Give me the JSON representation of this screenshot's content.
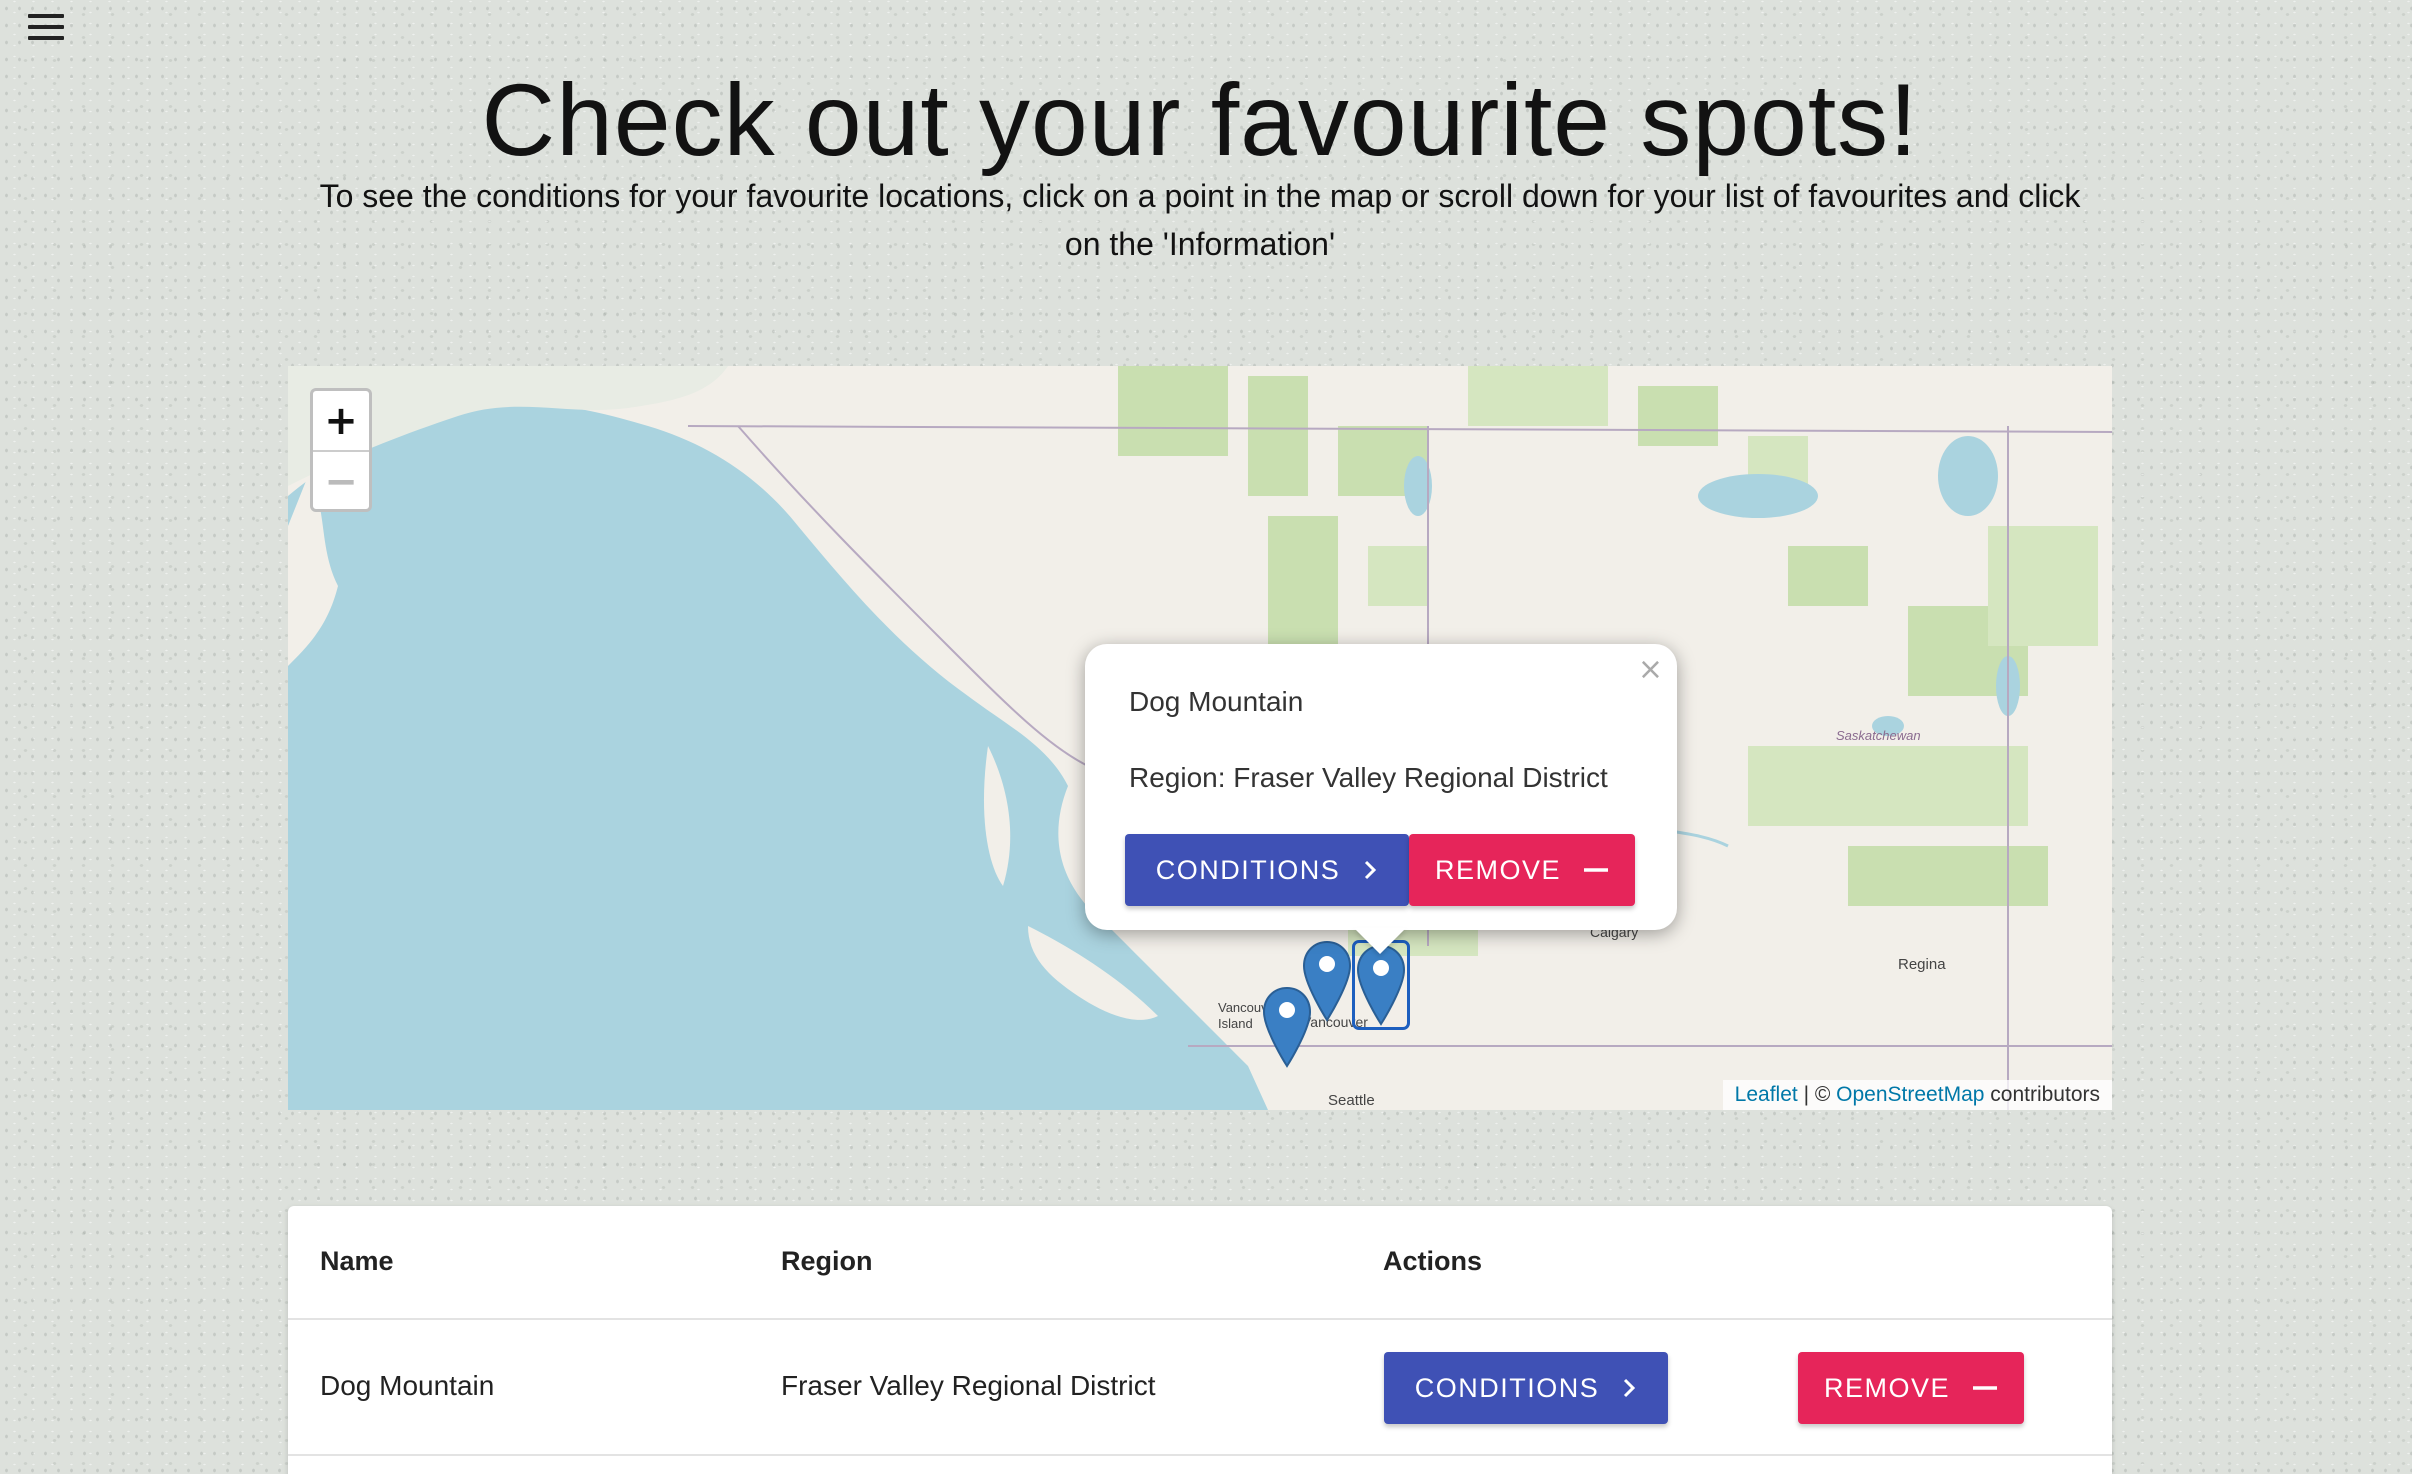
{
  "header": {
    "title": "Check out your favourite spots!",
    "subtitle_line1": "To see the conditions for your favourite locations, click on a point in the map or scroll down for your list of favourites and click",
    "subtitle_line2": "on the 'Information'"
  },
  "map": {
    "zoom_in": "+",
    "zoom_out": "−",
    "labels": {
      "seattle": "Seattle",
      "regina": "Regina",
      "saskatchewan": "Saskatchewan",
      "calgary": "Calgary",
      "vancouver_island": "Vancouver Island",
      "vancouver": "Vancouver"
    },
    "attribution": {
      "leaflet": "Leaflet",
      "separator": " | © ",
      "osm": "OpenStreetMap",
      "contributors": " contributors"
    },
    "popup": {
      "close": "×",
      "name": "Dog Mountain",
      "region": "Region: Fraser Valley Regional District",
      "conditions_label": "CONDITIONS",
      "remove_label": "REMOVE"
    },
    "colors": {
      "water": "#aad3df",
      "land": "#f2efe9",
      "park": "#c9dfb0",
      "marker": "#3a7fc4"
    }
  },
  "table": {
    "headers": [
      "Name",
      "Region",
      "Actions"
    ],
    "rows": [
      {
        "name": "Dog Mountain",
        "region": "Fraser Valley Regional District",
        "conditions_label": "CONDITIONS",
        "remove_label": "REMOVE"
      }
    ]
  },
  "colors": {
    "primary": "#3f51b5",
    "danger": "#e6255a"
  }
}
